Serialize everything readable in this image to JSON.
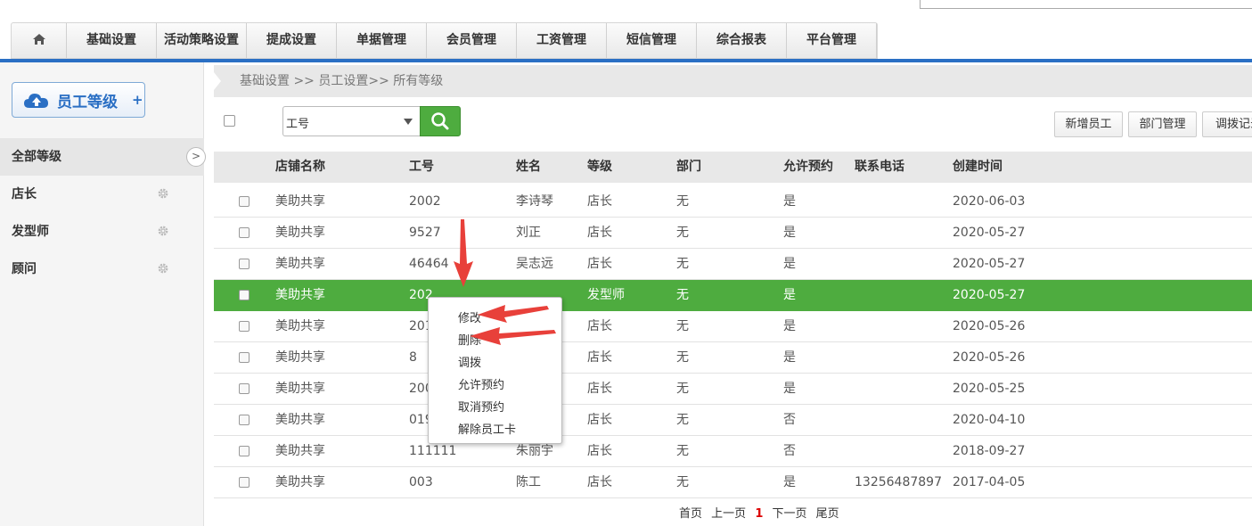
{
  "nav": {
    "items": [
      "基础设置",
      "活动策略设置",
      "提成设置",
      "单据管理",
      "会员管理",
      "工资管理",
      "短信管理",
      "综合报表",
      "平台管理"
    ]
  },
  "sidebar": {
    "level_button": {
      "label": "员工等级",
      "plus": "+"
    },
    "items": [
      {
        "label": "全部等级"
      },
      {
        "label": "店长"
      },
      {
        "label": "发型师"
      },
      {
        "label": "顾问"
      }
    ],
    "collapse_glyph": ">"
  },
  "breadcrumb": "基础设置 >> 员工设置>> 所有等级",
  "toolbar": {
    "search_field_value": "工号",
    "buttons": [
      "新增员工",
      "部门管理",
      "调拨记录"
    ]
  },
  "table": {
    "headers": [
      "店铺名称",
      "工号",
      "姓名",
      "等级",
      "部门",
      "允许预约",
      "联系电话",
      "创建时间"
    ],
    "rows": [
      {
        "shop": "美助共享",
        "id": "2002",
        "name": "李诗琴",
        "level": "店长",
        "dept": "无",
        "booking": "是",
        "phone": "",
        "created": "2020-06-03"
      },
      {
        "shop": "美助共享",
        "id": "9527",
        "name": "刘正",
        "level": "店长",
        "dept": "无",
        "booking": "是",
        "phone": "",
        "created": "2020-05-27"
      },
      {
        "shop": "美助共享",
        "id": "46464",
        "name": "吴志远",
        "level": "店长",
        "dept": "无",
        "booking": "是",
        "phone": "",
        "created": "2020-05-27"
      },
      {
        "shop": "美助共享",
        "id": "202",
        "name": "",
        "level": "发型师",
        "dept": "无",
        "booking": "是",
        "phone": "",
        "created": "2020-05-27"
      },
      {
        "shop": "美助共享",
        "id": "201",
        "name": "",
        "level": "店长",
        "dept": "无",
        "booking": "是",
        "phone": "",
        "created": "2020-05-26"
      },
      {
        "shop": "美助共享",
        "id": "8",
        "name": "",
        "level": "店长",
        "dept": "无",
        "booking": "是",
        "phone": "",
        "created": "2020-05-26"
      },
      {
        "shop": "美助共享",
        "id": "200",
        "name": "",
        "level": "店长",
        "dept": "无",
        "booking": "是",
        "phone": "",
        "created": "2020-05-25"
      },
      {
        "shop": "美助共享",
        "id": "019",
        "name": "",
        "level": "店长",
        "dept": "无",
        "booking": "否",
        "phone": "",
        "created": "2020-04-10"
      },
      {
        "shop": "美助共享",
        "id": "111111",
        "name": "朱丽宇",
        "level": "店长",
        "dept": "无",
        "booking": "否",
        "phone": "",
        "created": "2018-09-27"
      },
      {
        "shop": "美助共享",
        "id": "003",
        "name": "陈工",
        "level": "店长",
        "dept": "无",
        "booking": "是",
        "phone": "13256487897",
        "created": "2017-04-05"
      }
    ]
  },
  "context_menu": {
    "items": [
      "修改",
      "删除",
      "调拨",
      "允许预约",
      "取消预约",
      "解除员工卡"
    ]
  },
  "pagination": {
    "first": "首页",
    "prev": "上一页",
    "current": "1",
    "next": "下一页",
    "last": "尾页"
  },
  "colors": {
    "brand_blue": "#2a6fc4",
    "selected_row": "#4eac3f",
    "annotation_arrow": "#e8403a"
  }
}
